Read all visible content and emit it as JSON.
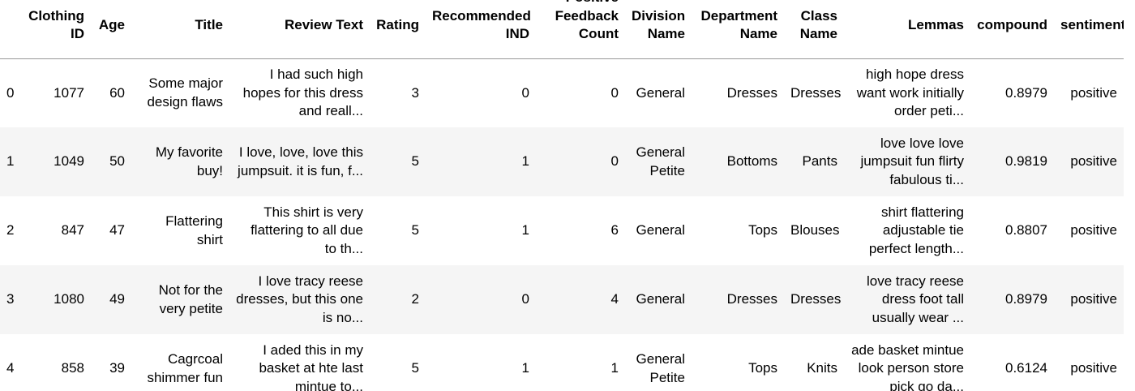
{
  "table": {
    "index_header": "",
    "columns": [
      "Clothing ID",
      "Age",
      "Title",
      "Review Text",
      "Rating",
      "Recommended IND",
      "Positive Feedback Count",
      "Division Name",
      "Department Name",
      "Class Name",
      "Lemmas",
      "compound",
      "sentiment"
    ],
    "rows": [
      {
        "index": "0",
        "cells": [
          "1077",
          "60",
          "Some major design flaws",
          "I had such high hopes for this dress and reall...",
          "3",
          "0",
          "0",
          "General",
          "Dresses",
          "Dresses",
          "high hope dress want work initially order peti...",
          "0.8979",
          "positive"
        ]
      },
      {
        "index": "1",
        "cells": [
          "1049",
          "50",
          "My favorite buy!",
          "I love, love, love this jumpsuit. it is fun, f...",
          "5",
          "1",
          "0",
          "General Petite",
          "Bottoms",
          "Pants",
          "love love love jumpsuit fun flirty fabulous ti...",
          "0.9819",
          "positive"
        ]
      },
      {
        "index": "2",
        "cells": [
          "847",
          "47",
          "Flattering shirt",
          "This shirt is very flattering to all due to th...",
          "5",
          "1",
          "6",
          "General",
          "Tops",
          "Blouses",
          "shirt flattering adjustable tie perfect length...",
          "0.8807",
          "positive"
        ]
      },
      {
        "index": "3",
        "cells": [
          "1080",
          "49",
          "Not for the very petite",
          "I love tracy reese dresses, but this one is no...",
          "2",
          "0",
          "4",
          "General",
          "Dresses",
          "Dresses",
          "love tracy reese dress foot tall usually wear ...",
          "0.8979",
          "positive"
        ]
      },
      {
        "index": "4",
        "cells": [
          "858",
          "39",
          "Cagrcoal shimmer fun",
          "I aded this in my basket at hte last mintue to...",
          "5",
          "1",
          "1",
          "General Petite",
          "Tops",
          "Knits",
          "ade basket mintue look person store pick go da...",
          "0.6124",
          "positive"
        ]
      }
    ]
  }
}
